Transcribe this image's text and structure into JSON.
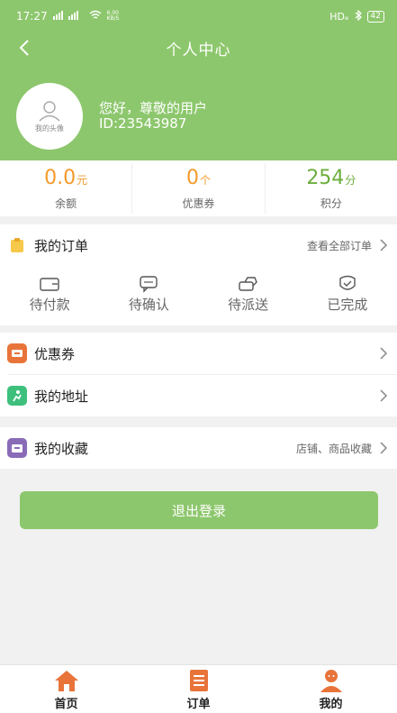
{
  "status_bar": {
    "time": "17:27",
    "signal": "ᵀᴵ⁲ ᵀᴵ⁲",
    "speed": "6.00 KB/S",
    "network": "HDₑ",
    "battery": "42"
  },
  "navbar": {
    "title": "个人中心"
  },
  "profile": {
    "avatar_label": "我的头像",
    "greeting": "您好，尊敬的用户",
    "user_id": "ID:23543987"
  },
  "stats": [
    {
      "value": "0.0",
      "unit": "元",
      "label": "余额"
    },
    {
      "value": "0",
      "unit": "个",
      "label": "优惠券"
    },
    {
      "value": "254",
      "unit": "分",
      "label": "积分"
    }
  ],
  "orders": {
    "title": "我的订单",
    "view_all": "查看全部订单",
    "statuses": [
      "待付款",
      "待确认",
      "待派送",
      "已完成"
    ]
  },
  "menu": {
    "coupons": "优惠券",
    "address": "我的地址",
    "favorites": "我的收藏",
    "favorites_extra": "店铺、商品收藏"
  },
  "logout_label": "退出登录",
  "tabbar": {
    "home": "首页",
    "orders": "订单",
    "mine": "我的"
  },
  "colors": {
    "brand": "#8dc76d",
    "accent": "#e8743a",
    "points": "#6cae3d",
    "balance": "#f39a2b"
  }
}
